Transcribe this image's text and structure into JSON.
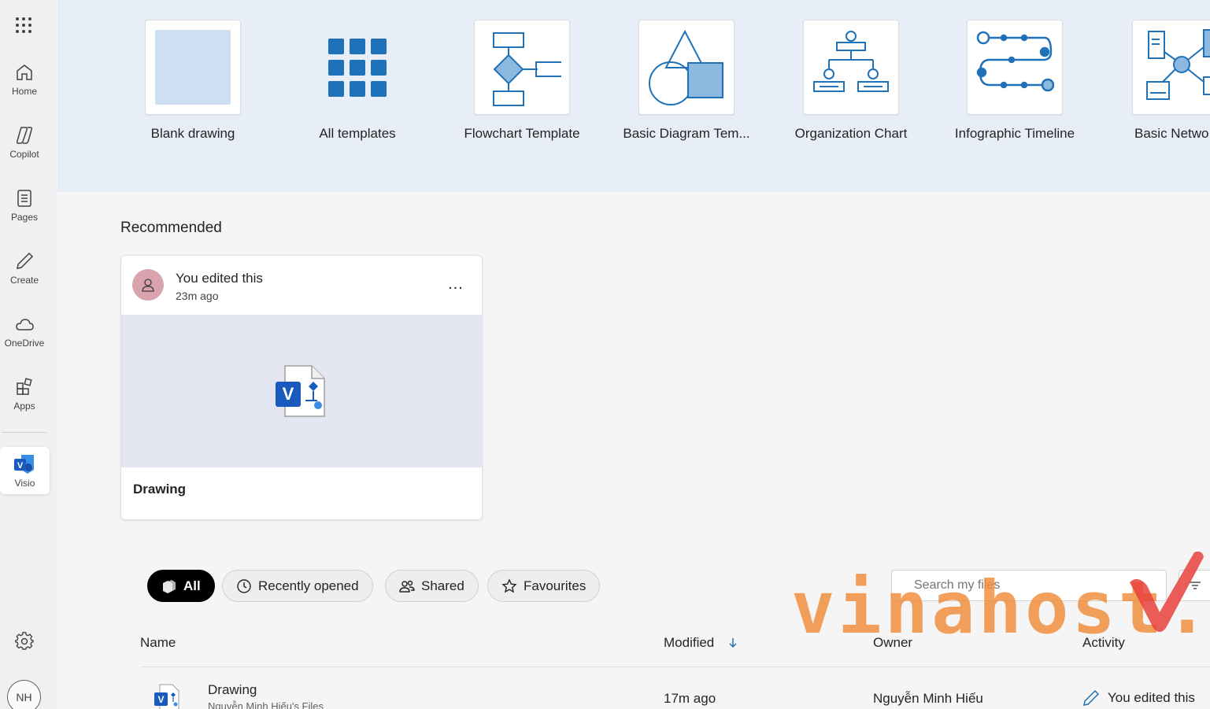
{
  "rail": {
    "items": [
      {
        "label": "Home",
        "icon": "home-icon"
      },
      {
        "label": "Copilot",
        "icon": "copilot-icon"
      },
      {
        "label": "Pages",
        "icon": "pages-icon"
      },
      {
        "label": "Create",
        "icon": "pen-icon"
      },
      {
        "label": "OneDrive",
        "icon": "cloud-icon"
      },
      {
        "label": "Apps",
        "icon": "apps-icon"
      }
    ],
    "active_app": {
      "label": "Visio",
      "icon": "visio-icon"
    },
    "avatar_initials": "NH"
  },
  "templates": [
    {
      "label": "Blank drawing"
    },
    {
      "label": "All templates"
    },
    {
      "label": "Flowchart Template"
    },
    {
      "label": "Basic Diagram Tem..."
    },
    {
      "label": "Organization Chart"
    },
    {
      "label": "Infographic Timeline"
    },
    {
      "label": "Basic Netwo"
    }
  ],
  "recommended": {
    "title": "Recommended",
    "card": {
      "activity": "You edited this",
      "time": "23m ago",
      "more": "...",
      "name": "Drawing"
    }
  },
  "filters": {
    "pills": [
      {
        "label": "All",
        "icon": "stack-icon"
      },
      {
        "label": "Recently opened",
        "icon": "clock-icon"
      },
      {
        "label": "Shared",
        "icon": "people-icon"
      },
      {
        "label": "Favourites",
        "icon": "star-icon"
      }
    ],
    "active": "All",
    "search_placeholder": "Search my files"
  },
  "table": {
    "columns": {
      "name": "Name",
      "modified": "Modified",
      "owner": "Owner",
      "activity": "Activity"
    },
    "sort_column": "Modified",
    "rows": [
      {
        "name": "Drawing",
        "location": "Nguyễn Minh Hiếu's Files",
        "modified": "17m ago",
        "owner": "Nguyễn Minh Hiếu",
        "activity": "You edited this"
      }
    ]
  },
  "watermark": {
    "text": "vinahost.v"
  },
  "colors": {
    "accent_blue": "#1f72b8",
    "visio_blue": "#185abd",
    "template_band": "#e8eef7",
    "watermark_orange": "#f28c3a",
    "watermark_red": "#e8413b"
  }
}
